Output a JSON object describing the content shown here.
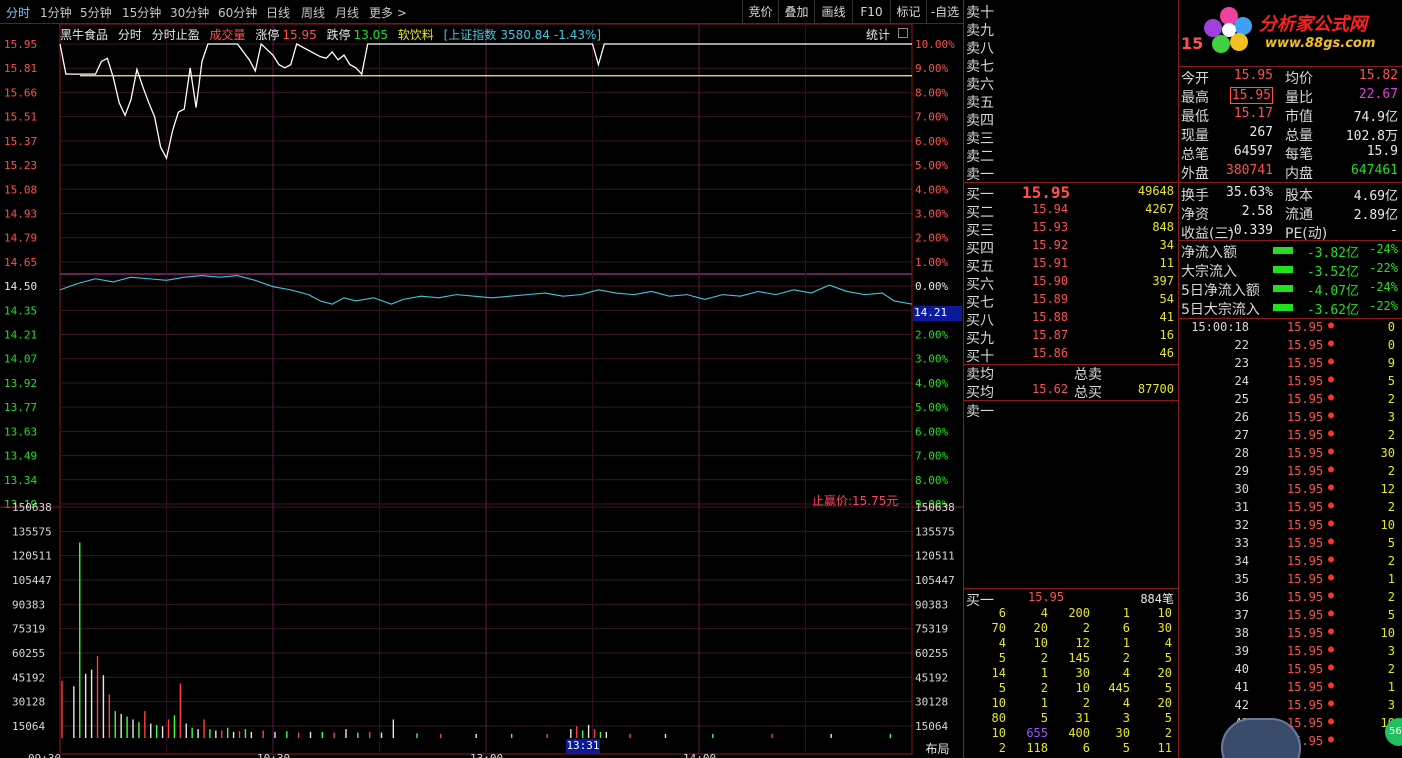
{
  "toolbar": {
    "periods": [
      "分时",
      "1分钟",
      "5分钟",
      "15分钟",
      "30分钟",
      "60分钟",
      "日线",
      "周线",
      "月线",
      "更多"
    ],
    "more_arrow": ">",
    "right_buttons": [
      "竞价",
      "叠加",
      "画线",
      "F10",
      "标记",
      "-自选"
    ]
  },
  "chart_header": {
    "stock_name": "黑牛食品",
    "mode1": "分时",
    "mode2": "分时止盈",
    "vol_label": "成交量",
    "limit_up_label": "涨停",
    "limit_up_value": "15.95",
    "limit_down_label": "跌停",
    "limit_down_value": "13.05",
    "sector": "软饮料",
    "index_name": "[上证指数",
    "index_value": "3580.84",
    "index_change": "-1.43%]",
    "stats_label": "统计",
    "stop_profit_label": "止赢价:15.75元",
    "layout_button": "布局",
    "cursor_price": "14.21",
    "cursor_time": "13:31"
  },
  "chart_data": {
    "type": "line",
    "price_axis": [
      "15.95",
      "15.81",
      "15.66",
      "15.51",
      "15.37",
      "15.23",
      "15.08",
      "14.93",
      "14.79",
      "14.65",
      "14.50",
      "14.35",
      "14.21",
      "14.07",
      "13.92",
      "13.77",
      "13.63",
      "13.49",
      "13.34",
      "13.19"
    ],
    "pct_axis": [
      "10.00%",
      "9.00%",
      "8.00%",
      "7.00%",
      "6.00%",
      "5.00%",
      "4.00%",
      "3.00%",
      "2.00%",
      "1.00%",
      "0.00%",
      "1.00%",
      "2.00%",
      "3.00%",
      "4.00%",
      "5.00%",
      "6.00%",
      "7.00%",
      "8.00%",
      "9.00%"
    ],
    "volume_axis": [
      "150638",
      "135575",
      "120511",
      "105447",
      "90383",
      "75319",
      "60255",
      "45192",
      "30128",
      "15064"
    ],
    "time_axis": [
      "09:30",
      "10:30",
      "13:00",
      "14:00"
    ],
    "ylim": [
      13.05,
      15.95
    ],
    "prev_close": 14.5,
    "stop_profit_price": 15.75,
    "price_series": [
      [
        0,
        15.95
      ],
      [
        1,
        15.76
      ],
      [
        2,
        15.76
      ],
      [
        3,
        15.76
      ],
      [
        4,
        15.76
      ],
      [
        5,
        15.76
      ],
      [
        6,
        15.76
      ],
      [
        7,
        15.84
      ],
      [
        8,
        15.86
      ],
      [
        9,
        15.74
      ],
      [
        10,
        15.58
      ],
      [
        11,
        15.5
      ],
      [
        12,
        15.6
      ],
      [
        13,
        15.79
      ],
      [
        14,
        15.68
      ],
      [
        15,
        15.58
      ],
      [
        16,
        15.49
      ],
      [
        17,
        15.3
      ],
      [
        18,
        15.23
      ],
      [
        19,
        15.4
      ],
      [
        20,
        15.52
      ],
      [
        21,
        15.54
      ],
      [
        22,
        15.8
      ],
      [
        23,
        15.55
      ],
      [
        24,
        15.84
      ],
      [
        25,
        15.95
      ],
      [
        30,
        15.95
      ],
      [
        31,
        15.9
      ],
      [
        32,
        15.85
      ],
      [
        33,
        15.78
      ],
      [
        34,
        15.95
      ],
      [
        36,
        15.88
      ],
      [
        37,
        15.82
      ],
      [
        38,
        15.8
      ],
      [
        39,
        15.82
      ],
      [
        40,
        15.95
      ],
      [
        44,
        15.87
      ],
      [
        45,
        15.86
      ],
      [
        46,
        15.9
      ],
      [
        47,
        15.85
      ],
      [
        48,
        15.88
      ],
      [
        49,
        15.82
      ],
      [
        50,
        15.8
      ],
      [
        51,
        15.76
      ],
      [
        52,
        15.95
      ],
      [
        90,
        15.95
      ],
      [
        91,
        15.82
      ],
      [
        92,
        15.95
      ],
      [
        144,
        15.95
      ]
    ],
    "avg_series": [
      [
        0,
        14.4
      ],
      [
        3,
        14.44
      ],
      [
        6,
        14.47
      ],
      [
        9,
        14.45
      ],
      [
        12,
        14.48
      ],
      [
        15,
        14.47
      ],
      [
        18,
        14.46
      ],
      [
        21,
        14.48
      ],
      [
        24,
        14.49
      ],
      [
        27,
        14.48
      ],
      [
        30,
        14.49
      ],
      [
        33,
        14.46
      ],
      [
        36,
        14.42
      ],
      [
        39,
        14.4
      ],
      [
        42,
        14.37
      ],
      [
        44,
        14.33
      ],
      [
        46,
        14.31
      ],
      [
        48,
        14.35
      ],
      [
        50,
        14.33
      ],
      [
        53,
        14.35
      ],
      [
        56,
        14.31
      ],
      [
        58,
        14.34
      ],
      [
        61,
        14.36
      ],
      [
        64,
        14.35
      ],
      [
        67,
        14.37
      ],
      [
        70,
        14.36
      ],
      [
        73,
        14.35
      ],
      [
        76,
        14.36
      ],
      [
        79,
        14.37
      ],
      [
        82,
        14.38
      ],
      [
        85,
        14.36
      ],
      [
        88,
        14.37
      ],
      [
        91,
        14.4
      ],
      [
        94,
        14.38
      ],
      [
        97,
        14.37
      ],
      [
        100,
        14.39
      ],
      [
        103,
        14.36
      ],
      [
        106,
        14.37
      ],
      [
        109,
        14.34
      ],
      [
        112,
        14.37
      ],
      [
        115,
        14.36
      ],
      [
        118,
        14.39
      ],
      [
        121,
        14.37
      ],
      [
        124,
        14.4
      ],
      [
        127,
        14.38
      ],
      [
        130,
        14.43
      ],
      [
        133,
        14.39
      ],
      [
        136,
        14.37
      ],
      [
        139,
        14.38
      ],
      [
        141,
        14.33
      ],
      [
        144,
        14.31
      ]
    ],
    "volume_series": [
      [
        0,
        40000,
        "r"
      ],
      [
        2,
        36000,
        "w"
      ],
      [
        3,
        140000,
        "g"
      ],
      [
        4,
        45000,
        "w"
      ],
      [
        5,
        48000,
        "w"
      ],
      [
        6,
        58000,
        "r"
      ],
      [
        7,
        44000,
        "w"
      ],
      [
        8,
        30000,
        "r"
      ],
      [
        9,
        18000,
        "g"
      ],
      [
        10,
        16000,
        "w"
      ],
      [
        11,
        14000,
        "g"
      ],
      [
        12,
        12000,
        "w"
      ],
      [
        13,
        10000,
        "g"
      ],
      [
        14,
        18000,
        "r"
      ],
      [
        15,
        9000,
        "w"
      ],
      [
        16,
        8000,
        "g"
      ],
      [
        17,
        7000,
        "w"
      ],
      [
        18,
        12000,
        "r"
      ],
      [
        19,
        15000,
        "g"
      ],
      [
        20,
        38000,
        "r"
      ],
      [
        21,
        9000,
        "w"
      ],
      [
        22,
        6000,
        "g"
      ],
      [
        23,
        5000,
        "w"
      ],
      [
        24,
        12000,
        "r"
      ],
      [
        25,
        5000,
        "g"
      ],
      [
        26,
        4000,
        "w"
      ],
      [
        27,
        4000,
        "r"
      ],
      [
        28,
        6000,
        "g"
      ],
      [
        29,
        3000,
        "w"
      ],
      [
        30,
        3500,
        "r"
      ],
      [
        31,
        5000,
        "g"
      ],
      [
        32,
        3000,
        "w"
      ],
      [
        34,
        4000,
        "r"
      ],
      [
        36,
        3000,
        "w"
      ],
      [
        38,
        3500,
        "g"
      ],
      [
        40,
        2500,
        "r"
      ],
      [
        42,
        3000,
        "w"
      ],
      [
        44,
        3000,
        "g"
      ],
      [
        46,
        2500,
        "r"
      ],
      [
        48,
        5000,
        "w"
      ],
      [
        50,
        2500,
        "g"
      ],
      [
        52,
        3000,
        "r"
      ],
      [
        54,
        2500,
        "w"
      ],
      [
        56,
        12000,
        "w"
      ],
      [
        60,
        2000,
        "g"
      ],
      [
        64,
        1500,
        "r"
      ],
      [
        70,
        1500,
        "w"
      ],
      [
        76,
        1500,
        "g"
      ],
      [
        82,
        1500,
        "r"
      ],
      [
        86,
        5000,
        "w"
      ],
      [
        87,
        7000,
        "r"
      ],
      [
        88,
        4000,
        "g"
      ],
      [
        89,
        8000,
        "w"
      ],
      [
        90,
        5000,
        "r"
      ],
      [
        91,
        3000,
        "g"
      ],
      [
        92,
        3000,
        "w"
      ],
      [
        96,
        1500,
        "r"
      ],
      [
        102,
        1500,
        "w"
      ],
      [
        110,
        1500,
        "g"
      ],
      [
        120,
        1500,
        "r"
      ],
      [
        130,
        1500,
        "w"
      ],
      [
        140,
        1500,
        "g"
      ]
    ]
  },
  "order_book": {
    "sell_labels": [
      "卖十",
      "卖九",
      "卖八",
      "卖七",
      "卖六",
      "卖五",
      "卖四",
      "卖三",
      "卖二",
      "卖一"
    ],
    "buy": [
      {
        "label": "买一",
        "price": "15.95",
        "vol": "49648"
      },
      {
        "label": "买二",
        "price": "15.94",
        "vol": "4267"
      },
      {
        "label": "买三",
        "price": "15.93",
        "vol": "848"
      },
      {
        "label": "买四",
        "price": "15.92",
        "vol": "34"
      },
      {
        "label": "买五",
        "price": "15.91",
        "vol": "11"
      },
      {
        "label": "买六",
        "price": "15.90",
        "vol": "397"
      },
      {
        "label": "买七",
        "price": "15.89",
        "vol": "54"
      },
      {
        "label": "买八",
        "price": "15.88",
        "vol": "41"
      },
      {
        "label": "买九",
        "price": "15.87",
        "vol": "16"
      },
      {
        "label": "买十",
        "price": "15.86",
        "vol": "46"
      }
    ],
    "sell_avg_label": "卖均",
    "sell_total_label": "总卖",
    "buy_avg_label": "买均",
    "buy_avg_value": "15.62",
    "buy_total_label": "总买",
    "buy_total_value": "87700",
    "sell1_label": "卖一",
    "queue_label": "买一",
    "queue_price": "15.95",
    "queue_count": "884笔",
    "queue_rows": [
      [
        "6",
        "4",
        "200",
        "1",
        "10"
      ],
      [
        "70",
        "20",
        "2",
        "6",
        "30"
      ],
      [
        "4",
        "10",
        "12",
        "1",
        "4"
      ],
      [
        "5",
        "2",
        "145",
        "2",
        "5"
      ],
      [
        "14",
        "1",
        "30",
        "4",
        "20"
      ],
      [
        "5",
        "2",
        "10",
        "445",
        "5"
      ],
      [
        "10",
        "1",
        "2",
        "4",
        "20"
      ],
      [
        "80",
        "5",
        "31",
        "3",
        "5"
      ],
      [
        "10",
        "655",
        "400",
        "30",
        "2"
      ],
      [
        "2",
        "118",
        "6",
        "5",
        "11"
      ]
    ]
  },
  "right_panel": {
    "logo_text": "分析家公式网",
    "logo_url": "www.88gs.com",
    "code_fragment": "15",
    "stats": [
      {
        "l1": "今开",
        "v1": "15.95",
        "c1": "#ff5050",
        "l2": "均价",
        "v2": "15.82",
        "c2": "#ff5050"
      },
      {
        "l1": "最高",
        "v1": "15.95",
        "c1": "#ff5050",
        "l2": "量比",
        "v2": "22.67",
        "c2": "#e040e0"
      },
      {
        "l1": "最低",
        "v1": "15.17",
        "c1": "#ff5050",
        "l2": "市值",
        "v2": "74.9亿",
        "c2": "#e8e8e8"
      },
      {
        "l1": "现量",
        "v1": "267",
        "c1": "#e8e8e8",
        "l2": "总量",
        "v2": "102.8万",
        "c2": "#e8e8e8"
      },
      {
        "l1": "总笔",
        "v1": "64597",
        "c1": "#e8e8e8",
        "l2": "每笔",
        "v2": "15.9",
        "c2": "#e8e8e8"
      },
      {
        "l1": "外盘",
        "v1": "380741",
        "c1": "#ff5050",
        "l2": "内盘",
        "v2": "647461",
        "c2": "#20e020"
      },
      {
        "l1": "换手",
        "v1": "35.63%",
        "c1": "#e8e8e8",
        "l2": "股本",
        "v2": "4.69亿",
        "c2": "#e8e8e8"
      },
      {
        "l1": "净资",
        "v1": "2.58",
        "c1": "#e8e8e8",
        "l2": "流通",
        "v2": "2.89亿",
        "c2": "#e8e8e8"
      },
      {
        "l1": "收益(三)",
        "v1": "-0.339",
        "c1": "#e8e8e8",
        "l2": "PE(动)",
        "v2": "-",
        "c2": "#e8e8e8"
      }
    ],
    "flows": [
      {
        "label": "净流入额",
        "value": "-3.82亿",
        "pct": "-24%"
      },
      {
        "label": "大宗流入",
        "value": "-3.52亿",
        "pct": "-22%"
      },
      {
        "label": "5日净流入额",
        "value": "-4.07亿",
        "pct": "-24%"
      },
      {
        "label": "5日大宗流入",
        "value": "-3.62亿",
        "pct": "-22%"
      }
    ],
    "ticks": [
      {
        "t": "15:00:18",
        "p": "15.95",
        "v": "0"
      },
      {
        "t": "22",
        "p": "15.95",
        "v": "0"
      },
      {
        "t": "23",
        "p": "15.95",
        "v": "9"
      },
      {
        "t": "24",
        "p": "15.95",
        "v": "5"
      },
      {
        "t": "25",
        "p": "15.95",
        "v": "2"
      },
      {
        "t": "26",
        "p": "15.95",
        "v": "3"
      },
      {
        "t": "27",
        "p": "15.95",
        "v": "2"
      },
      {
        "t": "28",
        "p": "15.95",
        "v": "30"
      },
      {
        "t": "29",
        "p": "15.95",
        "v": "2"
      },
      {
        "t": "30",
        "p": "15.95",
        "v": "12"
      },
      {
        "t": "31",
        "p": "15.95",
        "v": "2"
      },
      {
        "t": "32",
        "p": "15.95",
        "v": "10"
      },
      {
        "t": "33",
        "p": "15.95",
        "v": "5"
      },
      {
        "t": "34",
        "p": "15.95",
        "v": "2"
      },
      {
        "t": "35",
        "p": "15.95",
        "v": "1"
      },
      {
        "t": "36",
        "p": "15.95",
        "v": "2"
      },
      {
        "t": "37",
        "p": "15.95",
        "v": "5"
      },
      {
        "t": "38",
        "p": "15.95",
        "v": "10"
      },
      {
        "t": "39",
        "p": "15.95",
        "v": "3"
      },
      {
        "t": "40",
        "p": "15.95",
        "v": "2"
      },
      {
        "t": "41",
        "p": "15.95",
        "v": "1"
      },
      {
        "t": "42",
        "p": "15.95",
        "v": "3"
      },
      {
        "t": "43",
        "p": "15.95",
        "v": "10"
      },
      {
        "t": "",
        "p": "15.95",
        "v": ""
      }
    ],
    "badge": "56"
  }
}
